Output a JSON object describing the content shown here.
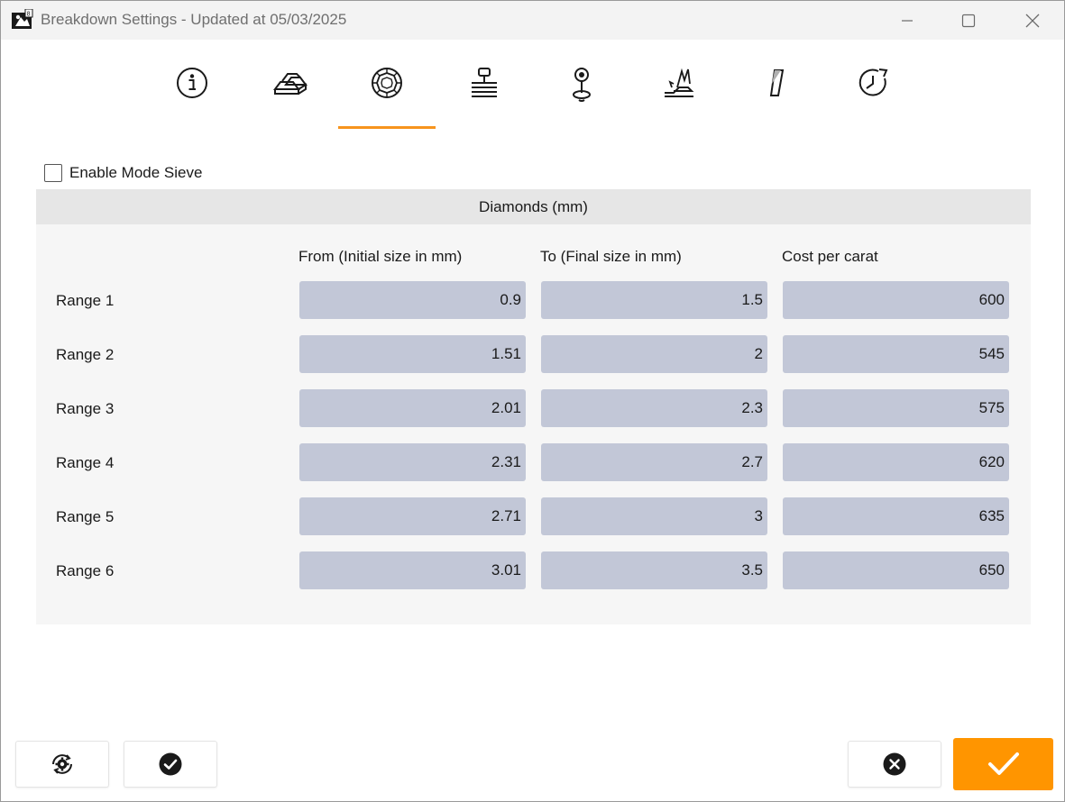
{
  "window": {
    "title": "Breakdown Settings - Updated at 05/03/2025"
  },
  "window_controls": [
    "minimize-icon",
    "maximize-icon",
    "close-icon"
  ],
  "tabs": [
    {
      "icon": "info-icon",
      "selected": false
    },
    {
      "icon": "gold-bars-icon",
      "selected": false
    },
    {
      "icon": "diamond-icon",
      "selected": true
    },
    {
      "icon": "stamp-icon",
      "selected": false
    },
    {
      "icon": "location-pin-icon",
      "selected": false
    },
    {
      "icon": "hand-tool-icon",
      "selected": false
    },
    {
      "icon": "pencil-icon",
      "selected": false
    },
    {
      "icon": "clock-history-icon",
      "selected": false
    }
  ],
  "enable_mode_sieve": {
    "label": "Enable Mode Sieve",
    "checked": false
  },
  "diamonds": {
    "header": "Diamonds (mm)",
    "columns": {
      "from": "From (Initial size in mm)",
      "to": "To (Final size in mm)",
      "cost": "Cost per carat"
    },
    "ranges": [
      {
        "label": "Range 1",
        "from": "0.9",
        "to": "1.5",
        "cost": "600"
      },
      {
        "label": "Range 2",
        "from": "1.51",
        "to": "2",
        "cost": "545"
      },
      {
        "label": "Range 3",
        "from": "2.01",
        "to": "2.3",
        "cost": "575"
      },
      {
        "label": "Range 4",
        "from": "2.31",
        "to": "2.7",
        "cost": "620"
      },
      {
        "label": "Range 5",
        "from": "2.71",
        "to": "3",
        "cost": "635"
      },
      {
        "label": "Range 6",
        "from": "3.01",
        "to": "3.5",
        "cost": "650"
      }
    ]
  },
  "footer": {
    "buttons": [
      "settings-sync-icon",
      "check-circle-icon",
      "cancel-circle-icon",
      "checkmark-icon"
    ]
  },
  "colors": {
    "accent": "#f7941d",
    "confirm": "#ff9500",
    "input_bg": "#c2c7d7",
    "panel_bg": "#f6f6f6",
    "panel_header_bg": "#e6e6e6"
  }
}
